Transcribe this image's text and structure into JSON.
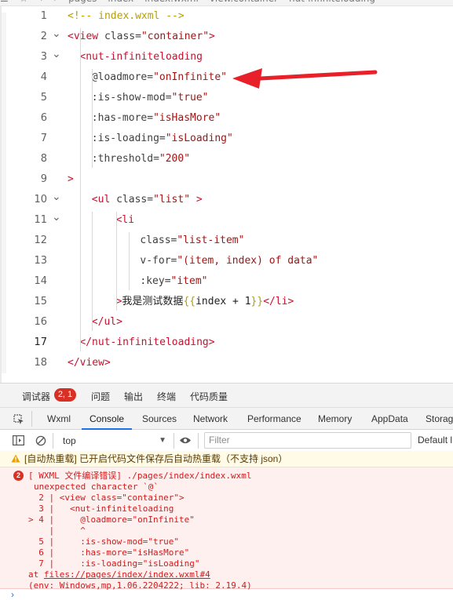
{
  "breadcrumb": [
    "☰",
    "☆",
    "‹",
    "›",
    "pages",
    "index",
    "index.wxml",
    "view.container",
    "nut-infiniteloading"
  ],
  "editor": {
    "lines": [
      {
        "n": "1",
        "indent": 0,
        "fold": "",
        "segs": [
          [
            "t-cmt",
            "<!-- index.wxml -->"
          ]
        ]
      },
      {
        "n": "2",
        "indent": 0,
        "fold": "v",
        "segs": [
          [
            "t-tag",
            "<view "
          ],
          [
            "t-attr",
            "class="
          ],
          [
            "t-str",
            "\"container\""
          ],
          [
            "t-tag",
            ">"
          ]
        ]
      },
      {
        "n": "3",
        "indent": 1,
        "fold": "v",
        "segs": [
          [
            "t-tag",
            "<nut-infiniteloading"
          ]
        ]
      },
      {
        "n": "4",
        "indent": 2,
        "fold": "",
        "segs": [
          [
            "t-attr",
            "@loadmore="
          ],
          [
            "t-str",
            "\"onInfinite\""
          ]
        ]
      },
      {
        "n": "5",
        "indent": 2,
        "fold": "",
        "segs": [
          [
            "t-attr",
            ":is-show-mod="
          ],
          [
            "t-str",
            "\"true\""
          ]
        ]
      },
      {
        "n": "6",
        "indent": 2,
        "fold": "",
        "segs": [
          [
            "t-attr",
            ":has-more="
          ],
          [
            "t-str",
            "\"isHasMore\""
          ]
        ]
      },
      {
        "n": "7",
        "indent": 2,
        "fold": "",
        "segs": [
          [
            "t-attr",
            ":is-loading="
          ],
          [
            "t-str",
            "\"isLoading\""
          ]
        ]
      },
      {
        "n": "8",
        "indent": 2,
        "fold": "",
        "segs": [
          [
            "t-attr",
            ":threshold="
          ],
          [
            "t-str",
            "\"200\""
          ]
        ]
      },
      {
        "n": "9",
        "indent": 0,
        "fold": "",
        "segs": [
          [
            "t-tag",
            ">"
          ]
        ]
      },
      {
        "n": "10",
        "indent": 2,
        "fold": "v",
        "segs": [
          [
            "t-tag",
            "<ul "
          ],
          [
            "t-attr",
            "class="
          ],
          [
            "t-str",
            "\"list\""
          ],
          [
            "t-tag",
            " >"
          ]
        ]
      },
      {
        "n": "11",
        "indent": 4,
        "fold": "v",
        "segs": [
          [
            "t-tag",
            "<li"
          ]
        ]
      },
      {
        "n": "12",
        "indent": 6,
        "fold": "",
        "segs": [
          [
            "t-attr",
            "class="
          ],
          [
            "t-str",
            "\"list-item\""
          ]
        ]
      },
      {
        "n": "13",
        "indent": 6,
        "fold": "",
        "segs": [
          [
            "t-attr",
            "v-for="
          ],
          [
            "t-str",
            "\"(item, index) of data\""
          ]
        ]
      },
      {
        "n": "14",
        "indent": 6,
        "fold": "",
        "segs": [
          [
            "t-attr",
            ":key="
          ],
          [
            "t-str",
            "\"item\""
          ]
        ]
      },
      {
        "n": "15",
        "indent": 4,
        "fold": "",
        "segs": [
          [
            "t-tag",
            ">"
          ],
          [
            "t-txt",
            "我是测试数据"
          ],
          [
            "t-br",
            "{{"
          ],
          [
            "t-txt",
            "index + 1"
          ],
          [
            "t-br",
            "}}"
          ],
          [
            "t-tag",
            "</li>"
          ]
        ]
      },
      {
        "n": "16",
        "indent": 2,
        "fold": "",
        "segs": [
          [
            "t-tag",
            "</ul>"
          ]
        ]
      },
      {
        "n": "17",
        "indent": 1,
        "fold": "",
        "segs": [
          [
            "t-tag",
            "</nut-infiniteloading>"
          ]
        ]
      },
      {
        "n": "18",
        "indent": 0,
        "fold": "",
        "segs": [
          [
            "t-tag",
            "</view>"
          ]
        ]
      }
    ]
  },
  "panel": {
    "top_tabs": [
      "调试器",
      "问题",
      "输出",
      "终端",
      "代码质量"
    ],
    "badge": "2, 1",
    "dev_tabs": [
      "Wxml",
      "Console",
      "Sources",
      "Network",
      "Performance",
      "Memory",
      "AppData",
      "Storage"
    ],
    "active_tab": "Console",
    "context": "top",
    "filter_placeholder": "Filter",
    "levels": "Default l",
    "warning": "[自动热重载] 已开启代码文件保存后自动热重载（不支持 json）",
    "error_count": "2",
    "error_lines": [
      "[ WXML 文件编译错误] ./pages/index/index.wxml",
      "unexpected character `@`",
      "  2 | <view class=\"container\">",
      "  3 |   <nut-infiniteloading",
      "> 4 |     @loadmore=\"onInfinite\"",
      "    |     ^",
      "  5 |     :is-show-mod=\"true\"",
      "  6 |     :has-more=\"isHasMore\"",
      "  7 |     :is-loading=\"isLoading\"",
      "at files://pages/index/index.wxml#4",
      "(env: Windows,mp,1.06.2204222; lib: 2.19.4)"
    ],
    "prompt": "›"
  },
  "colors": {
    "accent": "#1a73e8",
    "error": "#d01c1c",
    "arrow": "#e8202a"
  }
}
